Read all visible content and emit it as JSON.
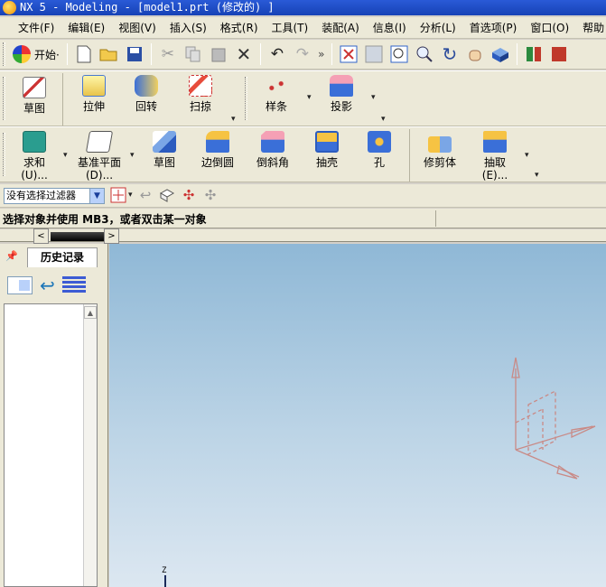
{
  "window": {
    "title": "NX 5 - Modeling - [model1.prt  (修改的) ]"
  },
  "menubar": {
    "items": [
      "文件(F)",
      "编辑(E)",
      "视图(V)",
      "插入(S)",
      "格式(R)",
      "工具(T)",
      "装配(A)",
      "信息(I)",
      "分析(L)",
      "首选项(P)",
      "窗口(O)",
      "帮助"
    ]
  },
  "toolbar": {
    "start_label": "开始·",
    "more_label": "»"
  },
  "ribbon1": {
    "buttons": [
      "草图",
      "拉伸",
      "回转",
      "扫掠",
      "样条",
      "投影"
    ]
  },
  "ribbon2": {
    "buttons": [
      "求和",
      "基准平面",
      "草图",
      "边倒圆",
      "倒斜角",
      "抽壳",
      "孔",
      "修剪体",
      "抽取"
    ],
    "sublabels": [
      "(U)...",
      "(D)...",
      "(E)..."
    ]
  },
  "filter": {
    "value": "没有选择过滤器"
  },
  "status": {
    "prompt": "选择对象并使用 MB3，或者双击某一对象"
  },
  "navigator": {
    "tab_label": "历史记录"
  },
  "viewport": {
    "axis_label": "Z"
  },
  "colors": {
    "titlebar": "#1a49c4",
    "chrome": "#ece9d8",
    "viewport_top": "#8fb8d6",
    "viewport_bottom": "#dce7f1",
    "wcs_triad": "#c98a86"
  }
}
